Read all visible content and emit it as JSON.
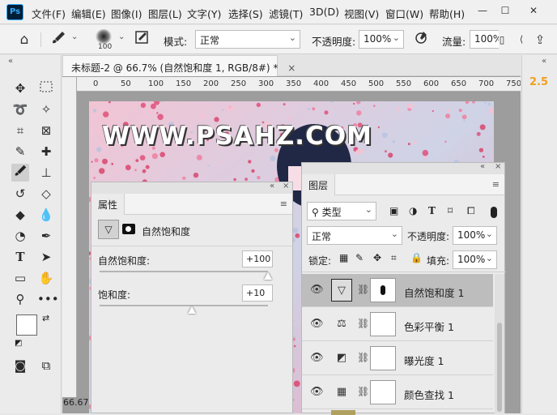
{
  "menu": {
    "app_logo": "Ps",
    "items": [
      "文件(F)",
      "编辑(E)",
      "图像(I)",
      "图层(L)",
      "文字(Y)",
      "选择(S)",
      "滤镜(T)",
      "3D(D)",
      "视图(V)",
      "窗口(W)",
      "帮助(H)"
    ]
  },
  "window_controls": {
    "minimize": "—",
    "restore": "☐",
    "close": "✕"
  },
  "options": {
    "brush_size": "100",
    "mode_label": "模式:",
    "mode_value": "正常",
    "opacity_label": "不透明度:",
    "opacity_value": "100%",
    "flow_label": "流量:",
    "flow_value": "100%"
  },
  "document": {
    "tab_title": "未标题-2 @ 66.7% (自然饱和度 1, RGB/8#) *",
    "tab_close": "×",
    "zoom": "66.67",
    "watermark": "WWW.PSAHZ.COM",
    "ruler_ticks": [
      "0",
      "50",
      "100",
      "150",
      "200",
      "250",
      "300",
      "350",
      "400",
      "450",
      "500",
      "550",
      "600",
      "650",
      "700",
      "750"
    ]
  },
  "right_strip": {
    "value": "2.5"
  },
  "properties": {
    "tab": "属性",
    "adjustment_name": "自然饱和度",
    "vibrance_label": "自然饱和度:",
    "vibrance_value": "+100",
    "vibrance_fraction": 1.0,
    "saturation_label": "饱和度:",
    "saturation_value": "+10",
    "saturation_fraction": 0.55
  },
  "layers": {
    "tab": "图层",
    "filter_kind": "类型",
    "blend_mode": "正常",
    "opacity_label": "不透明度:",
    "opacity_value": "100%",
    "lock_label": "锁定:",
    "fill_label": "填充:",
    "fill_value": "100%",
    "rows": [
      {
        "name": "自然饱和度 1",
        "icon": "vibrance-icon",
        "selected": true
      },
      {
        "name": "色彩平衡 1",
        "icon": "balance-scale-icon",
        "selected": false
      },
      {
        "name": "曝光度 1",
        "icon": "exposure-icon",
        "selected": false
      },
      {
        "name": "颜色查找 1",
        "icon": "grid-lookup-icon",
        "selected": false
      }
    ]
  },
  "colors": {
    "accent": "#31a8ff",
    "brand_bg": "#001e36",
    "value_orange": "#f0a020",
    "canvas_pink": "#e9b7c9"
  }
}
